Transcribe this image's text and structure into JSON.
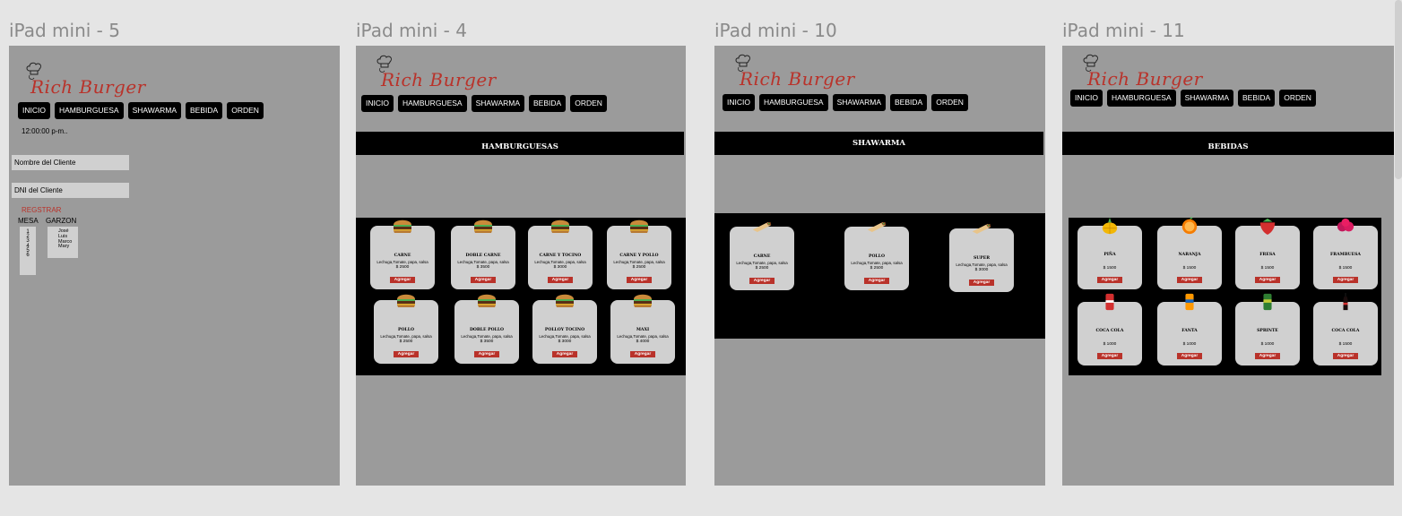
{
  "frames": {
    "f5": {
      "title": "iPad mini - 5"
    },
    "f4": {
      "title": "iPad mini - 4"
    },
    "f10": {
      "title": "iPad mini - 10"
    },
    "f11": {
      "title": "iPad mini - 11"
    }
  },
  "brand": {
    "logo_text": "Rich Burger",
    "accent": "#b9322a"
  },
  "nav": {
    "inicio": "INICIO",
    "hamburguesa": "HAMBURGUESA",
    "shawarma": "SHAWARMA",
    "bebida": "BEBIDA",
    "orden": "ORDEN"
  },
  "registro": {
    "time": "12:00:00 p-m..",
    "nombre_field": "Nombre  del Cliente",
    "dni_field": "DNI  del Cliente",
    "registrar_label": "REGSTRAR",
    "mesa_header": "MESA",
    "garzon_header": "GARZON",
    "mesas": [
      "1",
      "2",
      "3",
      "4",
      "5",
      "6"
    ],
    "garzones": [
      "José",
      "Luis",
      "Marco",
      "Mary"
    ]
  },
  "hamburguesas": {
    "banner": "HAMBURGUESAS",
    "items": [
      {
        "name": "CARNE",
        "desc": "Lechuga,Tomate, papa, salsa",
        "price": "$ 2500",
        "button": "Agregar",
        "icon": "burger-icon"
      },
      {
        "name": "DOBLE CARNE",
        "desc": "Lechuga,Tomate, papa, salsa",
        "price": "$ 3500",
        "button": "Agregar",
        "icon": "burger-icon"
      },
      {
        "name": "CARNE Y TOCINO",
        "desc": "Lechuga,Tomate, papa, salsa",
        "price": "$ 3000",
        "button": "Agregar",
        "icon": "burger-icon"
      },
      {
        "name": "CARNE Y POLLO",
        "desc": "Lechuga,Tomate, papa, salsa",
        "price": "$ 2500",
        "button": "Agregar",
        "icon": "burger-icon"
      },
      {
        "name": "POLLO",
        "desc": "Lechuga,Tomate, papa, salsa",
        "price": "$ 2500",
        "button": "Agregar",
        "icon": "burger-icon"
      },
      {
        "name": "DOBLE POLLO",
        "desc": "Lechuga,Tomate, papa, salsa",
        "price": "$ 3500",
        "button": "Agregar",
        "icon": "burger-icon"
      },
      {
        "name": "POLLOY TOCINO",
        "desc": "Lechuga,Tomate, papa, salsa",
        "price": "$ 3000",
        "button": "Agregar",
        "icon": "burger-icon"
      },
      {
        "name": "MAXI",
        "desc": "Lechuga,Tomate, papa, salsa",
        "price": "$ 4000",
        "button": "Agregar",
        "icon": "burger-icon"
      }
    ]
  },
  "shawarma": {
    "banner": "SHAWARMA",
    "items": [
      {
        "name": "CARNE",
        "desc": "Lechuga,Tomate, papa, salsa",
        "price": "$ 2500",
        "button": "Agregar",
        "icon": "shawarma-icon"
      },
      {
        "name": "POLLO",
        "desc": "Lechuga,Tomate, papa, salsa",
        "price": "$ 2500",
        "button": "Agregar",
        "icon": "shawarma-icon"
      },
      {
        "name": "SUPER",
        "desc": "Lechuga,Tomate, papa, salsa",
        "price": "$ 3000",
        "button": "Agregar",
        "icon": "shawarma-icon"
      }
    ]
  },
  "bebidas": {
    "banner": "BEBIDAS",
    "items": [
      {
        "name": "PIÑA",
        "price": "$ 1500",
        "button": "Agregar",
        "icon": "pineapple-icon"
      },
      {
        "name": "NARANJA",
        "price": "$ 1500",
        "button": "Agregar",
        "icon": "orange-icon"
      },
      {
        "name": "FRESA",
        "price": "$ 1500",
        "button": "Agregar",
        "icon": "strawberry-icon"
      },
      {
        "name": "FRAMBUESA",
        "price": "$ 1500",
        "button": "Agregar",
        "icon": "raspberry-icon"
      },
      {
        "name": "COCA COLA",
        "price": "$ 1000",
        "button": "Agregar",
        "icon": "soda-can-icon"
      },
      {
        "name": "FANTA",
        "price": "$ 1000",
        "button": "Agregar",
        "icon": "fanta-icon"
      },
      {
        "name": "SPRINTE",
        "price": "$ 1000",
        "button": "Agregar",
        "icon": "sprite-icon"
      },
      {
        "name": "COCA COLA",
        "price": "$ 1500",
        "button": "Agregar",
        "icon": "cola-bottle-icon"
      }
    ]
  }
}
